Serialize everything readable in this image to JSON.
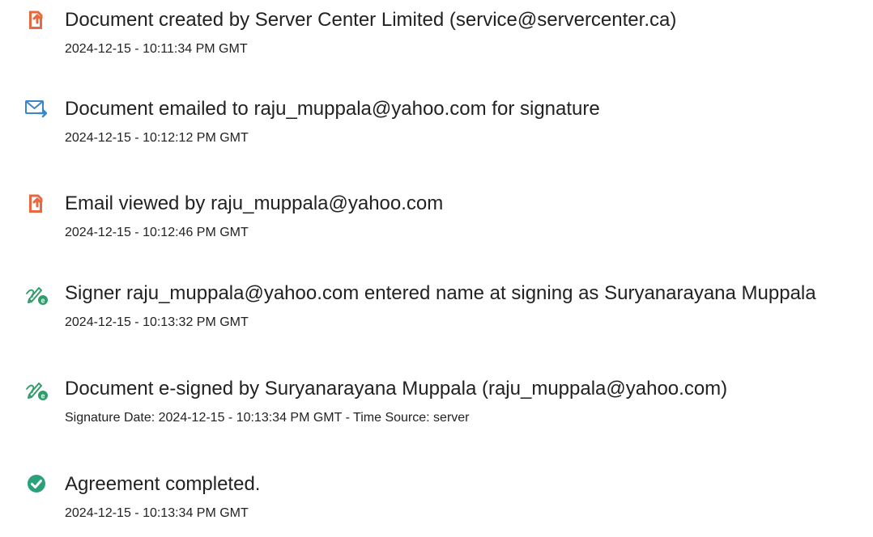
{
  "events": [
    {
      "icon": "document-icon",
      "title": "Document created by Server Center Limited (service@servercenter.ca)",
      "detail": "2024-12-15 - 10:11:34 PM GMT"
    },
    {
      "icon": "email-icon",
      "title": "Document emailed to raju_muppala@yahoo.com for signature",
      "detail": "2024-12-15 - 10:12:12 PM GMT"
    },
    {
      "icon": "document-icon",
      "title": "Email viewed by raju_muppala@yahoo.com",
      "detail": "2024-12-15 - 10:12:46 PM GMT"
    },
    {
      "icon": "signature-pen-icon",
      "title": "Signer raju_muppala@yahoo.com entered name at signing as Suryanarayana Muppala",
      "detail": "2024-12-15 - 10:13:32 PM GMT"
    },
    {
      "icon": "signature-pen-icon",
      "title": "Document e-signed by Suryanarayana Muppala (raju_muppala@yahoo.com)",
      "detail": "Signature Date: 2024-12-15 - 10:13:34 PM GMT - Time Source: server"
    },
    {
      "icon": "check-circle-icon",
      "title": "Agreement completed.",
      "detail": "2024-12-15 - 10:13:34 PM GMT"
    }
  ],
  "colors": {
    "document_icon": "#e8683f",
    "email_icon": "#3b86c8",
    "signature_icon": "#2f9e6a",
    "check_icon": "#2aa17a"
  }
}
